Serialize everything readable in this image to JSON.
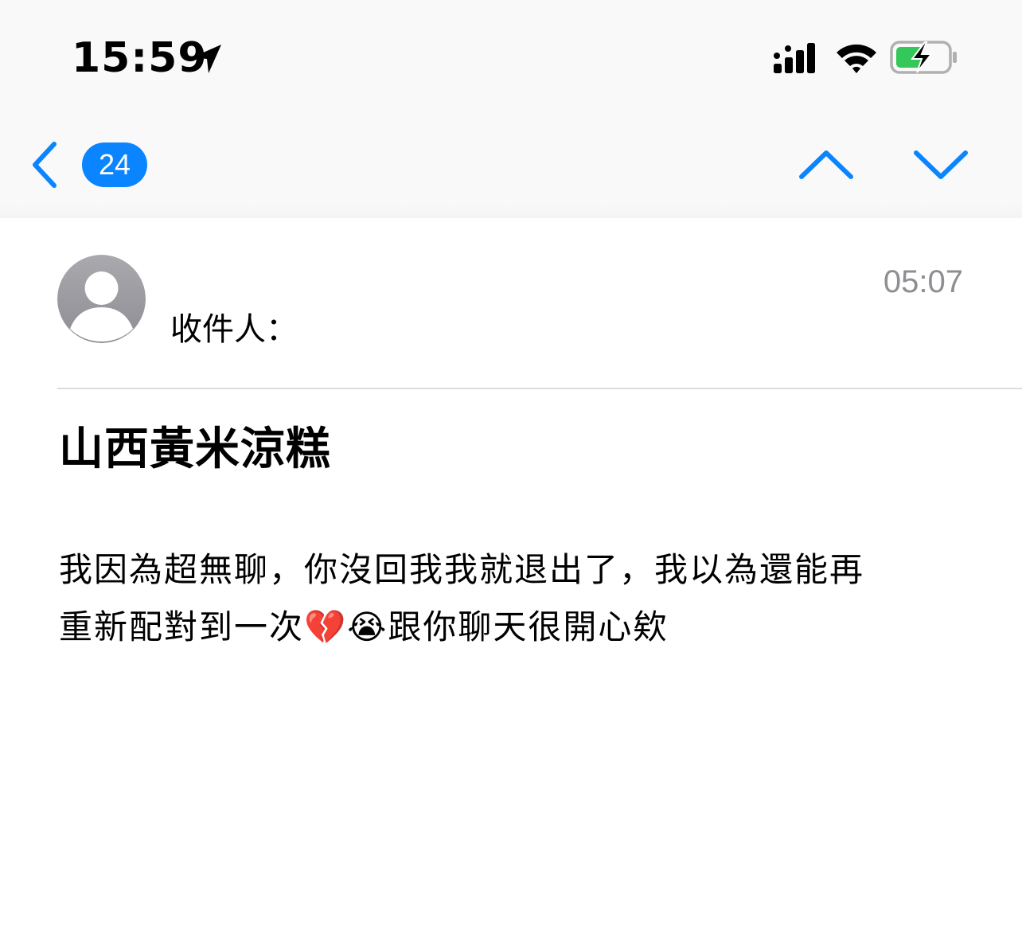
{
  "status_bar": {
    "time": "15:59",
    "icons": [
      "location-arrow-icon",
      "cellular-signal-icon",
      "wifi-icon",
      "battery-charging-icon"
    ]
  },
  "nav": {
    "unread_count": "24",
    "icons": [
      "chevron-left-icon",
      "chevron-up-icon",
      "chevron-down-icon"
    ]
  },
  "email": {
    "recipient_label": "收件人：",
    "time": "05:07",
    "subject": "山西黃米涼糕",
    "body_line1": "我因為超無聊，你沒回我我就退出了，我以為還能再",
    "body_line2": "重新配對到一次💔😭跟你聊天很開心欸"
  },
  "colors": {
    "accent": "#0a84ff",
    "secondary_text": "#8e8e93",
    "battery_green": "#34c759",
    "avatar_gray": "#a3a3a8"
  }
}
